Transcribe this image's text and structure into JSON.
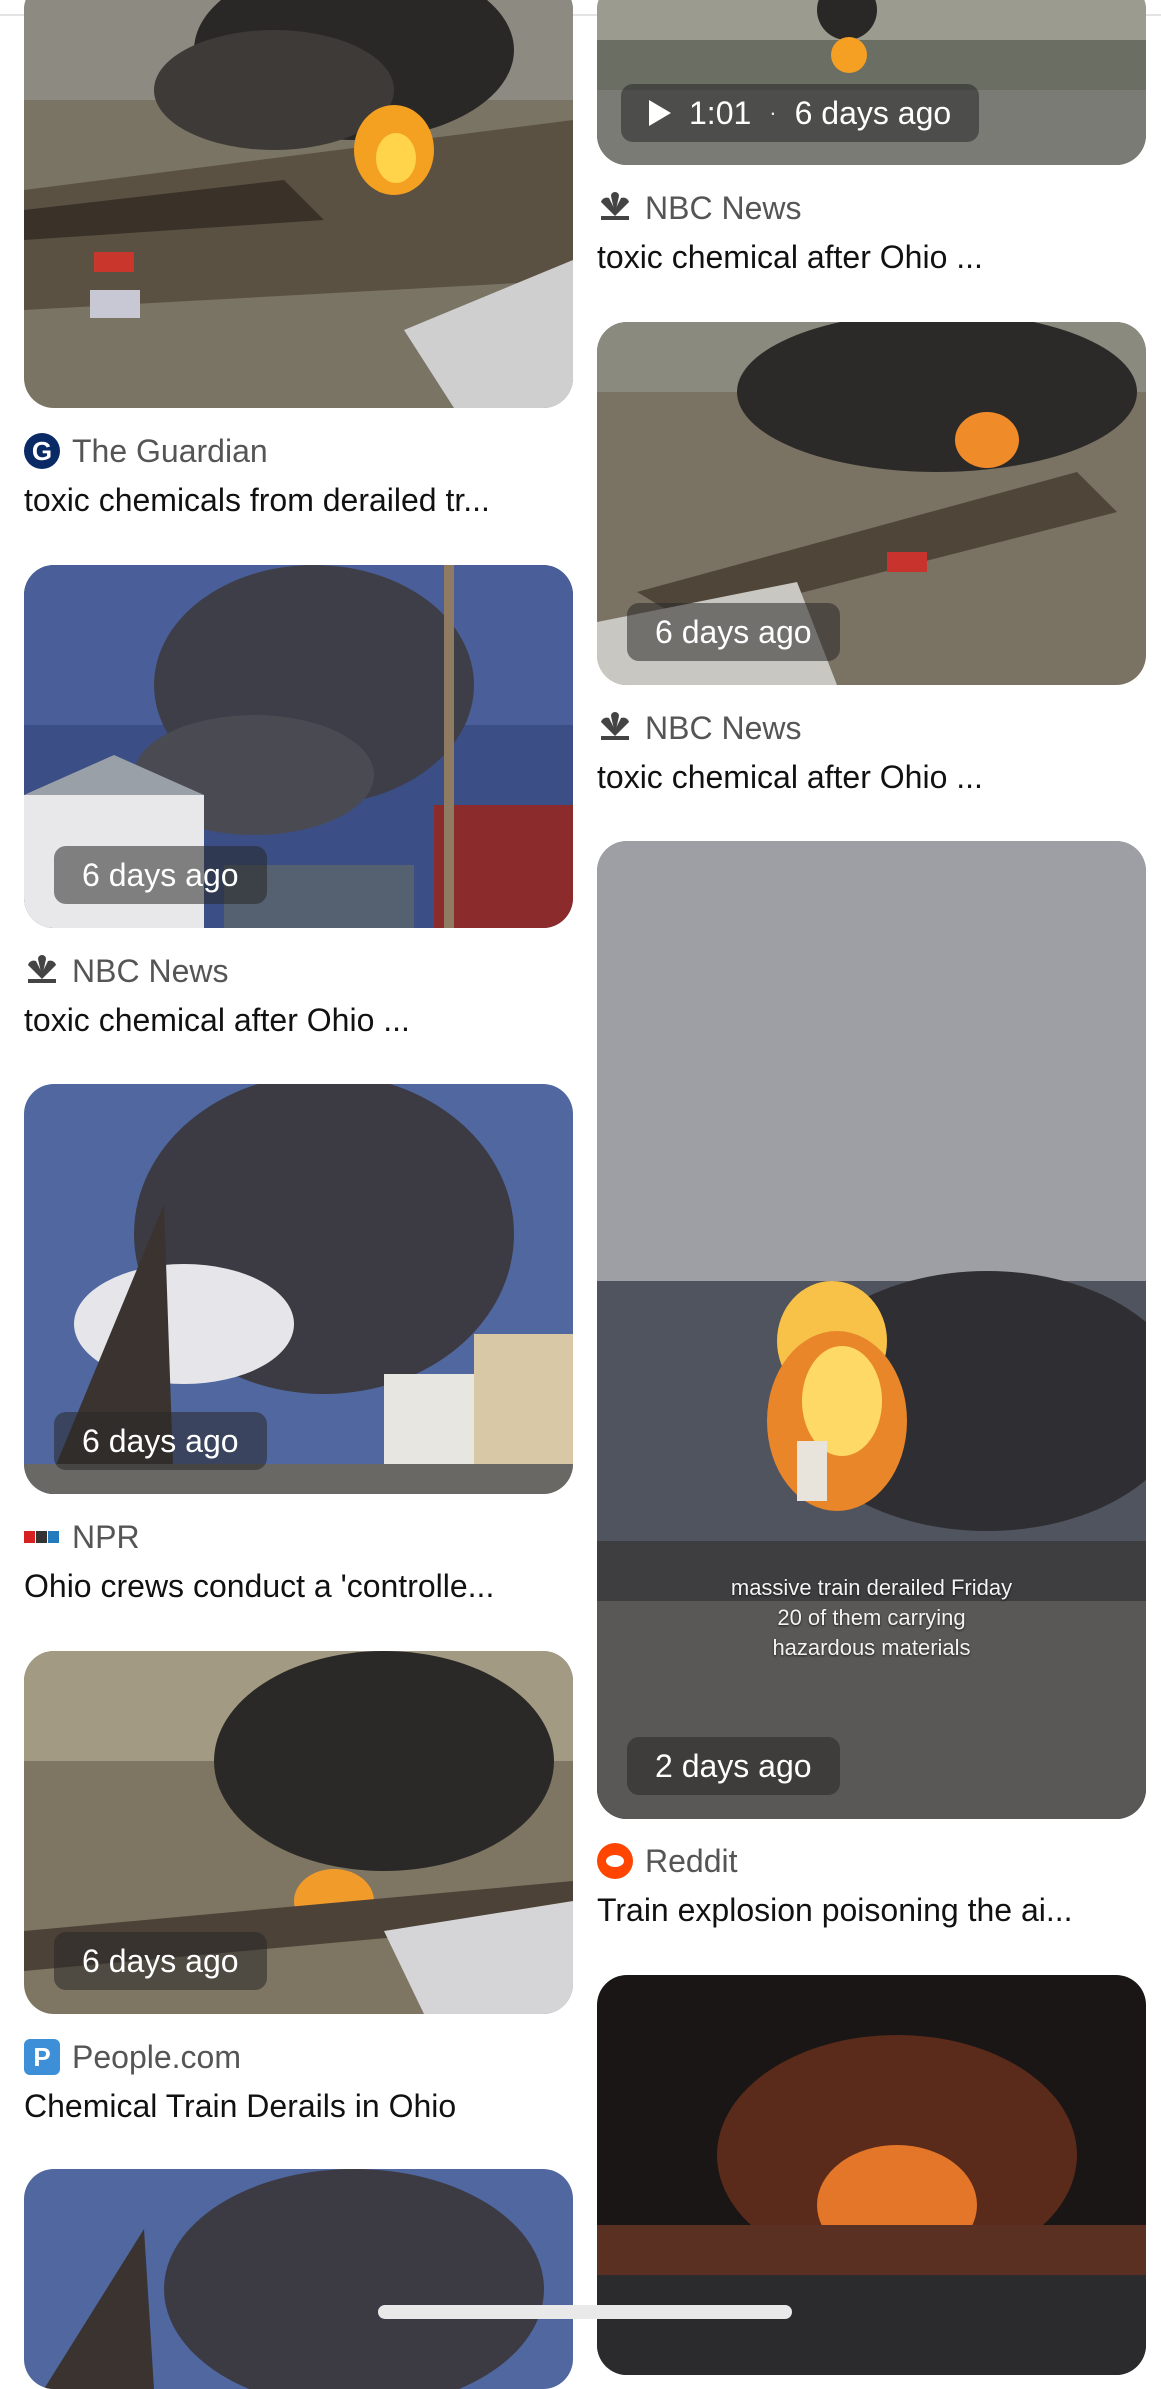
{
  "left_column": [
    {
      "source": "The Guardian",
      "source_icon": "guardian-icon",
      "title": "toxic chemicals from derailed tr...",
      "badge": ""
    },
    {
      "source": "NBC News",
      "source_icon": "nbc-peacock-icon",
      "title": "toxic chemical after Ohio ...",
      "badge": "6 days ago"
    },
    {
      "source": "NPR",
      "source_icon": "npr-icon",
      "title": "Ohio crews conduct a 'controlle...",
      "badge": "6 days ago"
    },
    {
      "source": "People.com",
      "source_icon": "people-icon",
      "title": "Chemical Train Derails in Ohio",
      "badge": "6 days ago"
    }
  ],
  "right_column": [
    {
      "source": "NBC News",
      "source_icon": "nbc-peacock-icon",
      "title": "toxic chemical after Ohio ...",
      "badge_duration": "1:01",
      "badge": "6 days ago"
    },
    {
      "source": "NBC News",
      "source_icon": "nbc-peacock-icon",
      "title": "toxic chemical after Ohio ...",
      "badge": "6 days ago"
    },
    {
      "source": "Reddit",
      "source_icon": "reddit-icon",
      "title": "Train explosion poisoning the ai...",
      "badge": "2 days ago",
      "overlay_text": [
        "massive train derailed Friday",
        "20 of them carrying",
        "hazardous materials"
      ]
    }
  ]
}
